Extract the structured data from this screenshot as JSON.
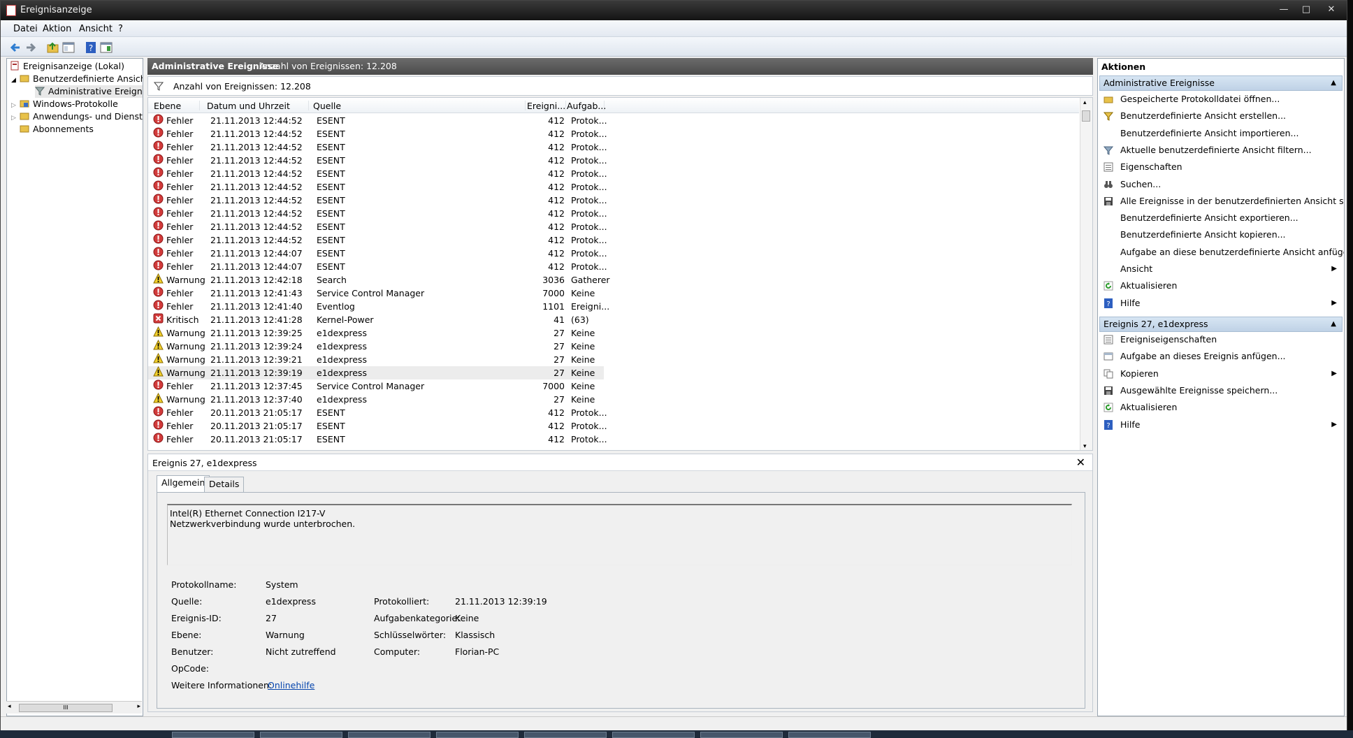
{
  "window": {
    "title": "Ereignisanzeige",
    "min": "—",
    "max": "□",
    "close": "✕"
  },
  "menu": [
    "Datei",
    "Aktion",
    "Ansicht",
    "?"
  ],
  "tree": {
    "items": [
      {
        "label": "Ereignisanzeige (Lokal)"
      },
      {
        "label": "Benutzerdefinierte Ansichten"
      },
      {
        "label": "Administrative Ereignisse"
      },
      {
        "label": "Windows-Protokolle"
      },
      {
        "label": "Anwendungs- und Dienstprotokolle"
      },
      {
        "label": "Abonnements"
      }
    ],
    "scroll_glyph": "III"
  },
  "center": {
    "title": "Administrative Ereignisse",
    "count_label": "Anzahl von Ereignissen: 12.208",
    "filter_text": "Anzahl von Ereignissen: 12.208",
    "columns": [
      "Ebene",
      "Datum und Uhrzeit",
      "Quelle",
      "Ereigni...",
      "Aufgab..."
    ],
    "rows": [
      {
        "level": "Fehler",
        "datetime": "21.11.2013 12:44:52",
        "source": "ESENT",
        "id": "412",
        "task": "Protok..."
      },
      {
        "level": "Fehler",
        "datetime": "21.11.2013 12:44:52",
        "source": "ESENT",
        "id": "412",
        "task": "Protok..."
      },
      {
        "level": "Fehler",
        "datetime": "21.11.2013 12:44:52",
        "source": "ESENT",
        "id": "412",
        "task": "Protok..."
      },
      {
        "level": "Fehler",
        "datetime": "21.11.2013 12:44:52",
        "source": "ESENT",
        "id": "412",
        "task": "Protok..."
      },
      {
        "level": "Fehler",
        "datetime": "21.11.2013 12:44:52",
        "source": "ESENT",
        "id": "412",
        "task": "Protok..."
      },
      {
        "level": "Fehler",
        "datetime": "21.11.2013 12:44:52",
        "source": "ESENT",
        "id": "412",
        "task": "Protok..."
      },
      {
        "level": "Fehler",
        "datetime": "21.11.2013 12:44:52",
        "source": "ESENT",
        "id": "412",
        "task": "Protok..."
      },
      {
        "level": "Fehler",
        "datetime": "21.11.2013 12:44:52",
        "source": "ESENT",
        "id": "412",
        "task": "Protok..."
      },
      {
        "level": "Fehler",
        "datetime": "21.11.2013 12:44:52",
        "source": "ESENT",
        "id": "412",
        "task": "Protok..."
      },
      {
        "level": "Fehler",
        "datetime": "21.11.2013 12:44:52",
        "source": "ESENT",
        "id": "412",
        "task": "Protok..."
      },
      {
        "level": "Fehler",
        "datetime": "21.11.2013 12:44:07",
        "source": "ESENT",
        "id": "412",
        "task": "Protok..."
      },
      {
        "level": "Fehler",
        "datetime": "21.11.2013 12:44:07",
        "source": "ESENT",
        "id": "412",
        "task": "Protok..."
      },
      {
        "level": "Warnung",
        "datetime": "21.11.2013 12:42:18",
        "source": "Search",
        "id": "3036",
        "task": "Gatherer"
      },
      {
        "level": "Fehler",
        "datetime": "21.11.2013 12:41:43",
        "source": "Service Control Manager",
        "id": "7000",
        "task": "Keine"
      },
      {
        "level": "Fehler",
        "datetime": "21.11.2013 12:41:40",
        "source": "Eventlog",
        "id": "1101",
        "task": "Ereigni..."
      },
      {
        "level": "Kritisch",
        "datetime": "21.11.2013 12:41:28",
        "source": "Kernel-Power",
        "id": "41",
        "task": "(63)"
      },
      {
        "level": "Warnung",
        "datetime": "21.11.2013 12:39:25",
        "source": "e1dexpress",
        "id": "27",
        "task": "Keine"
      },
      {
        "level": "Warnung",
        "datetime": "21.11.2013 12:39:24",
        "source": "e1dexpress",
        "id": "27",
        "task": "Keine"
      },
      {
        "level": "Warnung",
        "datetime": "21.11.2013 12:39:21",
        "source": "e1dexpress",
        "id": "27",
        "task": "Keine"
      },
      {
        "level": "Warnung",
        "datetime": "21.11.2013 12:39:19",
        "source": "e1dexpress",
        "id": "27",
        "task": "Keine"
      },
      {
        "level": "Fehler",
        "datetime": "21.11.2013 12:37:45",
        "source": "Service Control Manager",
        "id": "7000",
        "task": "Keine"
      },
      {
        "level": "Warnung",
        "datetime": "21.11.2013 12:37:40",
        "source": "e1dexpress",
        "id": "27",
        "task": "Keine"
      },
      {
        "level": "Fehler",
        "datetime": "20.11.2013 21:05:17",
        "source": "ESENT",
        "id": "412",
        "task": "Protok..."
      },
      {
        "level": "Fehler",
        "datetime": "20.11.2013 21:05:17",
        "source": "ESENT",
        "id": "412",
        "task": "Protok..."
      },
      {
        "level": "Fehler",
        "datetime": "20.11.2013 21:05:17",
        "source": "ESENT",
        "id": "412",
        "task": "Protok..."
      }
    ],
    "selected_row": 19
  },
  "detail": {
    "title": "Ereignis 27, e1dexpress",
    "close": "✕",
    "tabs": [
      "Allgemein",
      "Details"
    ],
    "message": [
      "Intel(R) Ethernet Connection I217-V",
      "Netzwerkverbindung wurde unterbrochen."
    ],
    "props": {
      "log_name_label": "Protokollname:",
      "log_name": "System",
      "source_label": "Quelle:",
      "source": "e1dexpress",
      "logged_label": "Protokolliert:",
      "logged": "21.11.2013 12:39:19",
      "event_id_label": "Ereignis-ID:",
      "event_id": "27",
      "task_cat_label": "Aufgabenkategorie:",
      "task_cat": "Keine",
      "level_label": "Ebene:",
      "level": "Warnung",
      "keywords_label": "Schlüsselwörter:",
      "keywords": "Klassisch",
      "user_label": "Benutzer:",
      "user": "Nicht zutreffend",
      "computer_label": "Computer:",
      "computer": "Florian-PC",
      "opcode_label": "OpCode:",
      "opcode": "",
      "more_info_label": "Weitere Informationen:",
      "more_info_link": "Onlinehilfe"
    }
  },
  "actions": {
    "title": "Aktionen",
    "section1": {
      "title": "Administrative Ereignisse",
      "items": [
        {
          "label": "Gespeicherte Protokolldatei öffnen...",
          "icon": "folder-open-icon"
        },
        {
          "label": "Benutzerdefinierte Ansicht erstellen...",
          "icon": "filter-add-icon"
        },
        {
          "label": "Benutzerdefinierte Ansicht importieren...",
          "icon": ""
        },
        {
          "label": "Aktuelle benutzerdefinierte Ansicht filtern...",
          "icon": "filter-icon"
        },
        {
          "label": "Eigenschaften",
          "icon": "properties-icon"
        },
        {
          "label": "Suchen...",
          "icon": "binoculars-icon"
        },
        {
          "label": "Alle Ereignisse in der benutzerdefinierten Ansicht speic...",
          "icon": "save-icon"
        },
        {
          "label": "Benutzerdefinierte Ansicht exportieren...",
          "icon": ""
        },
        {
          "label": "Benutzerdefinierte Ansicht kopieren...",
          "icon": ""
        },
        {
          "label": "Aufgabe an diese benutzerdefinierte Ansicht anfügen...",
          "icon": ""
        },
        {
          "label": "Ansicht",
          "icon": "",
          "submenu": true
        },
        {
          "label": "Aktualisieren",
          "icon": "refresh-icon"
        },
        {
          "label": "Hilfe",
          "icon": "help-icon",
          "submenu": true
        }
      ]
    },
    "section2": {
      "title": "Ereignis 27, e1dexpress",
      "items": [
        {
          "label": "Ereigniseigenschaften",
          "icon": "properties-icon"
        },
        {
          "label": "Aufgabe an dieses Ereignis anfügen...",
          "icon": "task-icon"
        },
        {
          "label": "Kopieren",
          "icon": "copy-icon",
          "submenu": true
        },
        {
          "label": "Ausgewählte Ereignisse speichern...",
          "icon": "save-icon"
        },
        {
          "label": "Aktualisieren",
          "icon": "refresh-icon"
        },
        {
          "label": "Hilfe",
          "icon": "help-icon",
          "submenu": true
        }
      ]
    }
  }
}
